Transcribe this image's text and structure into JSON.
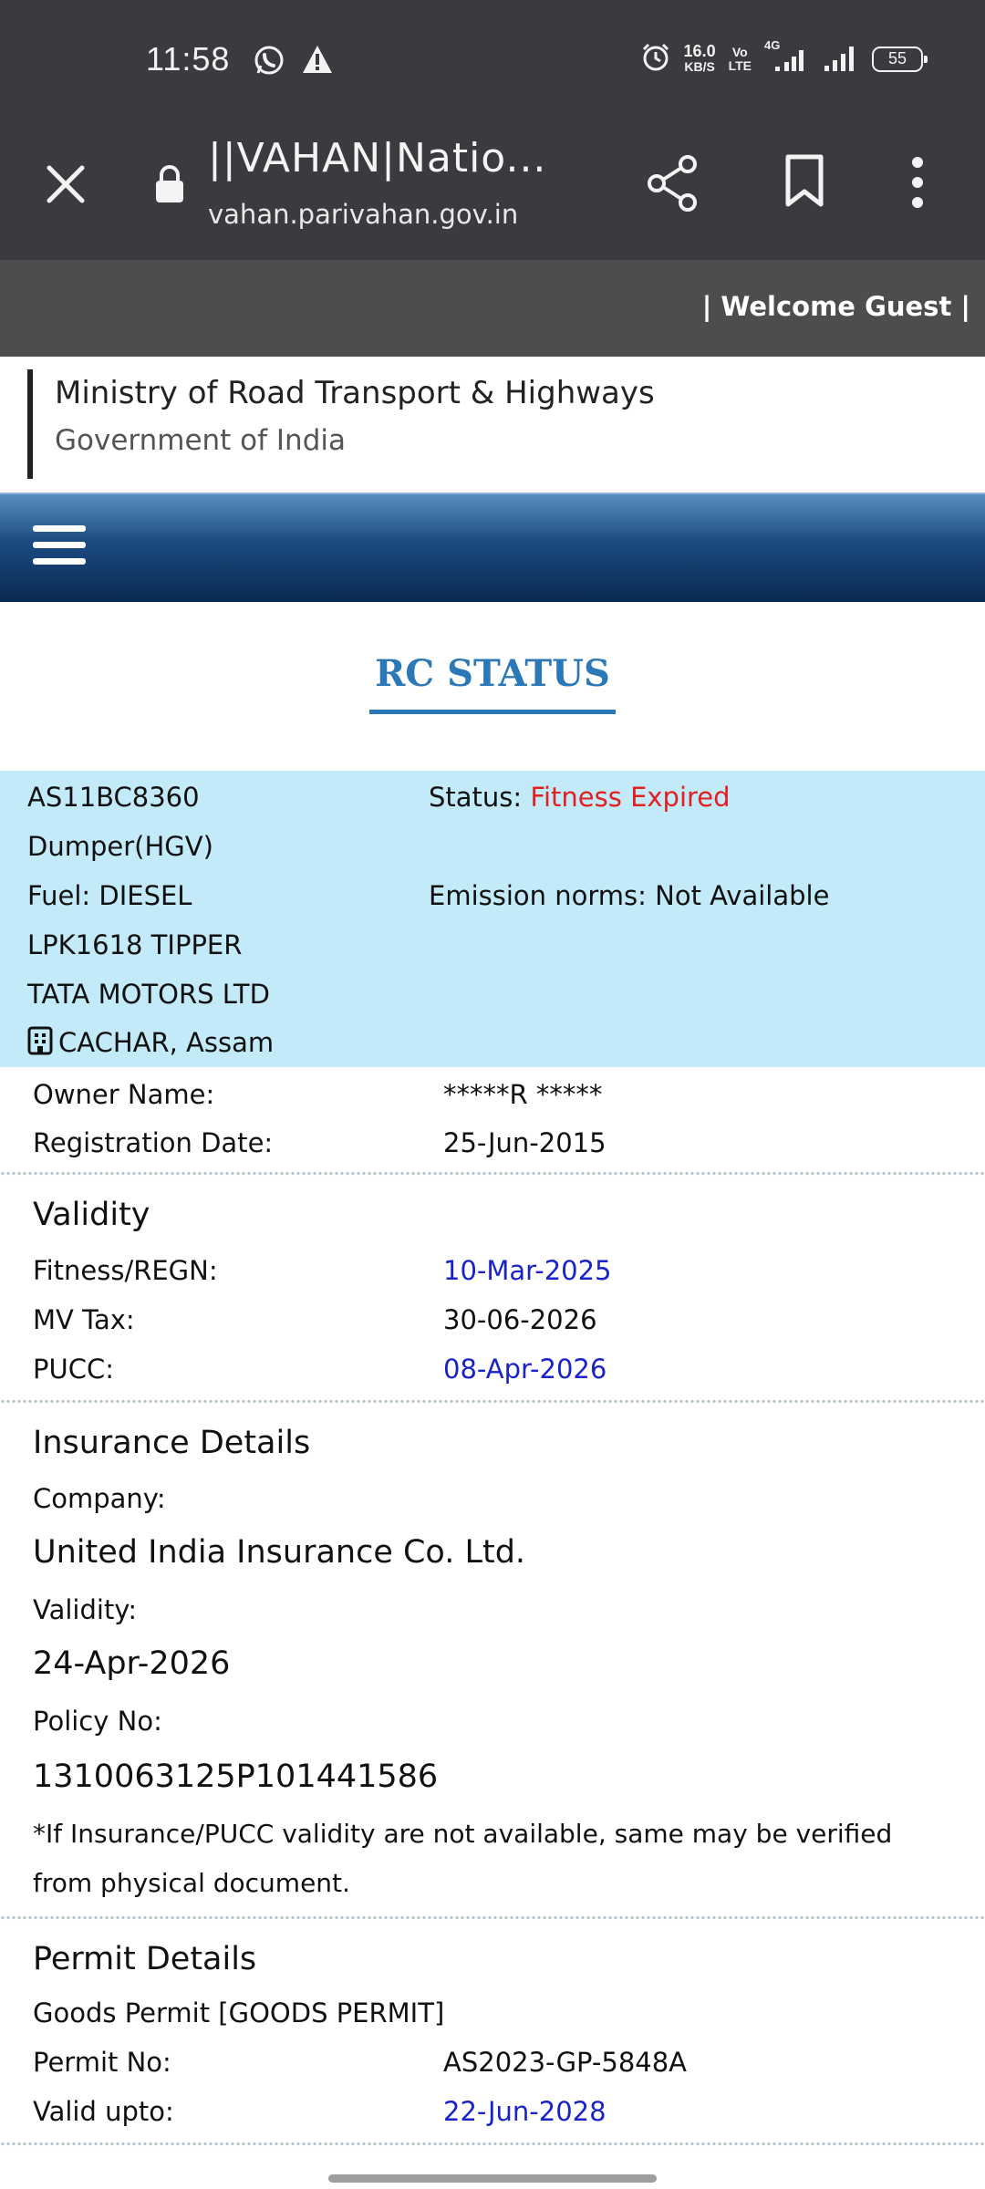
{
  "statusbar": {
    "time": "11:58",
    "speed_value": "16.0",
    "speed_unit": "KB/S",
    "volte": "Vo",
    "volte2": "LTE",
    "network": "4G",
    "battery": "55",
    "icons": [
      "whatsapp-icon",
      "warning-icon",
      "alarm-icon",
      "signal-icon",
      "battery-icon"
    ]
  },
  "browser": {
    "title": "||VAHAN|Natio...",
    "url": "vahan.parivahan.gov.in"
  },
  "site": {
    "welcome": "| Welcome Guest |",
    "ministry": "Ministry of Road Transport & Highways",
    "government": "Government of India",
    "page_heading": "RC STATUS"
  },
  "vehicle": {
    "reg_no": "AS11BC8360",
    "status_label": "Status:",
    "status_value": "Fitness Expired",
    "class": "Dumper(HGV)",
    "fuel": "Fuel: DIESEL",
    "emission": "Emission norms: Not Available",
    "model": "LPK1618 TIPPER",
    "maker": "TATA MOTORS LTD",
    "rto": "CACHAR, Assam"
  },
  "owner": {
    "owner_label": "Owner Name:",
    "owner_value": "*****R *****",
    "reg_date_label": "Registration Date:",
    "reg_date_value": "25-Jun-2015"
  },
  "validity": {
    "heading": "Validity",
    "fitness_label": "Fitness/REGN:",
    "fitness_value": "10-Mar-2025",
    "mvtax_label": "MV Tax:",
    "mvtax_value": "30-06-2026",
    "pucc_label": "PUCC:",
    "pucc_value": "08-Apr-2026"
  },
  "insurance": {
    "heading": "Insurance Details",
    "company_label": "Company:",
    "company_value": "United India Insurance Co. Ltd.",
    "validity_label": "Validity:",
    "validity_value": "24-Apr-2026",
    "policy_label": "Policy No:",
    "policy_value": "1310063125P101441586",
    "note_line1": "*If Insurance/PUCC validity are not available, same may be verified",
    "note_line2": "from physical document."
  },
  "permit": {
    "heading": "Permit Details",
    "type": "Goods Permit [GOODS PERMIT]",
    "permit_no_label": "Permit No:",
    "permit_no_value": "AS2023-GP-5848A",
    "valid_upto_label": "Valid upto:",
    "valid_upto_value": "22-Jun-2028"
  },
  "colors": {
    "status_red": "#e32020",
    "date_blue": "#1a22c9",
    "heading_blue": "#2c78b6",
    "vehicle_box": "#c2eaf9"
  }
}
